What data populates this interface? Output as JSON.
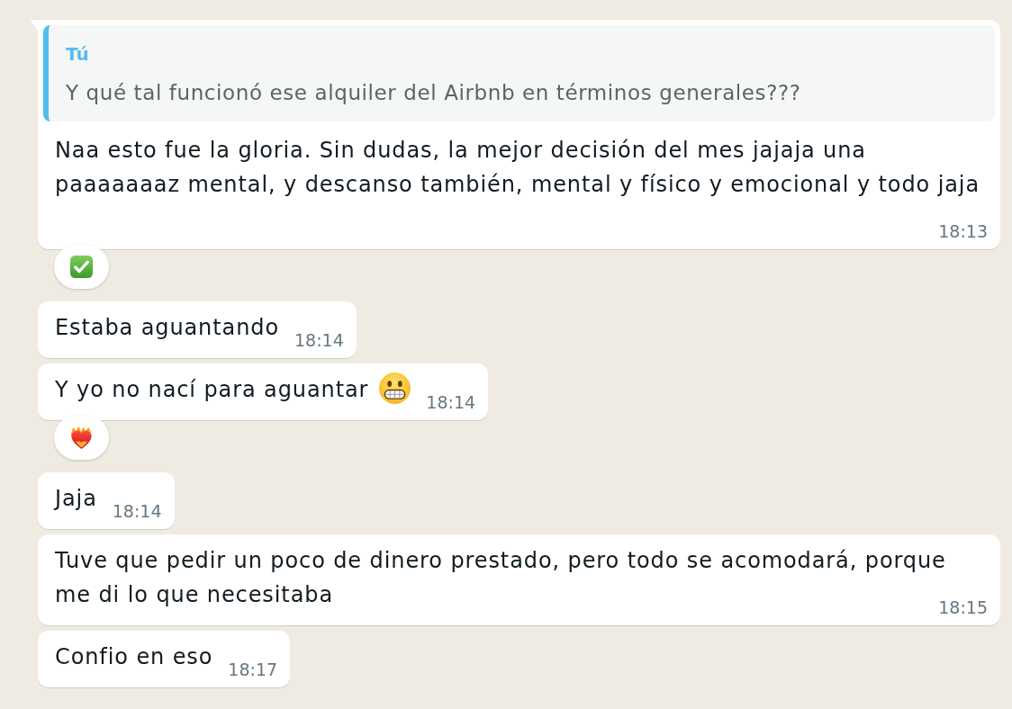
{
  "messages": [
    {
      "tail": true,
      "quote": {
        "author": "Tú",
        "text": "Y qué tal funcionó ese alquiler del Airbnb en términos generales???"
      },
      "text": "Naa esto fue la gloria. Sin dudas, la mejor decisión del mes jajaja una\npaaaaaaaz mental, y descanso también, mental y físico y emocional y todo jaja",
      "time": "18:13",
      "reaction": {
        "kind": "check"
      }
    },
    {
      "tail": false,
      "text": "Estaba aguantando",
      "time": "18:14"
    },
    {
      "tail": false,
      "text": "Y yo no nací para aguantar",
      "emoji": {
        "kind": "grimacing-face"
      },
      "time": "18:14",
      "reaction": {
        "kind": "heart-on-fire"
      }
    },
    {
      "tail": false,
      "text": "Jaja",
      "time": "18:14"
    },
    {
      "tail": false,
      "text": "Tuve que pedir un poco de dinero prestado, pero todo se acomodará, porque\nme di lo que necesitaba",
      "time": "18:15"
    },
    {
      "tail": false,
      "text": "Confio en eso",
      "time": "18:17"
    }
  ]
}
